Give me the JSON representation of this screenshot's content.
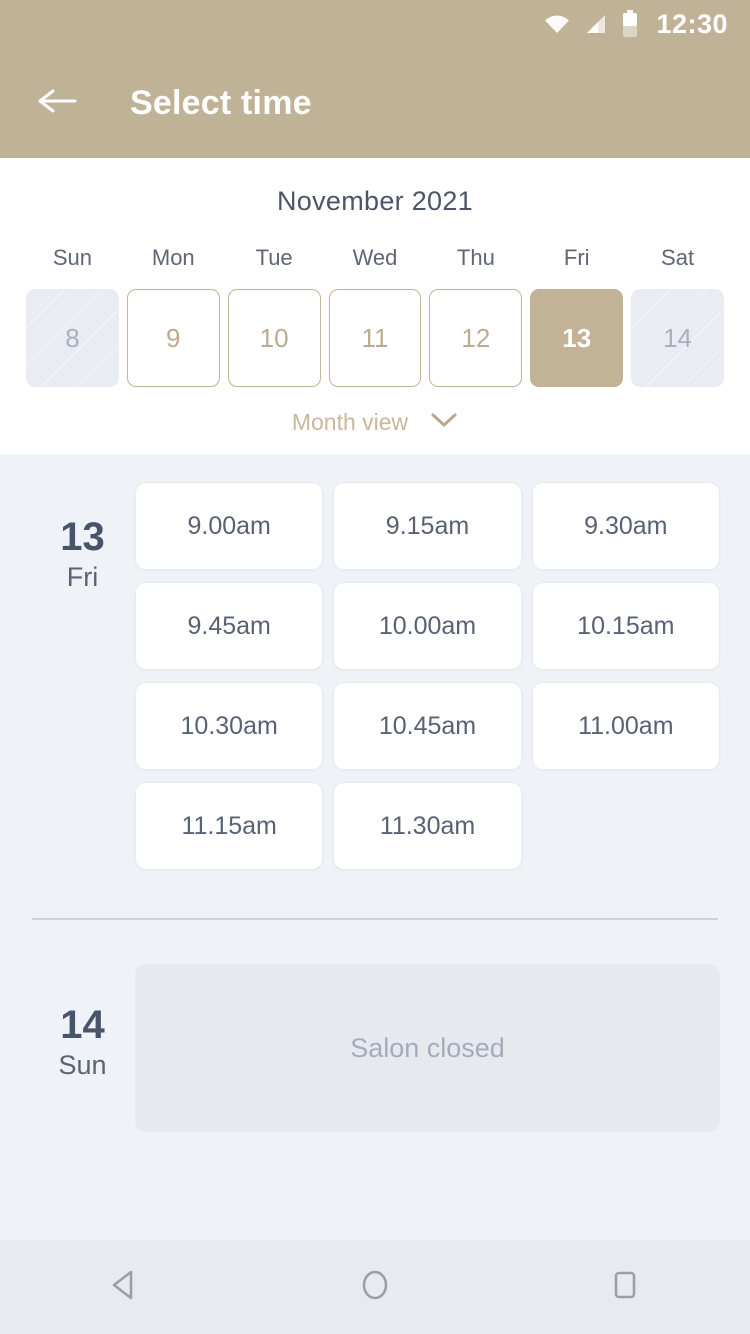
{
  "status_bar": {
    "time": "12:30",
    "icons": [
      "wifi-icon",
      "signal-icon",
      "battery-icon"
    ]
  },
  "app_bar": {
    "back_icon": "back-arrow-icon",
    "title": "Select time"
  },
  "calendar": {
    "month_title": "November 2021",
    "day_names": [
      "Sun",
      "Mon",
      "Tue",
      "Wed",
      "Thu",
      "Fri",
      "Sat"
    ],
    "dates": [
      {
        "number": "8",
        "state": "disabled"
      },
      {
        "number": "9",
        "state": "available"
      },
      {
        "number": "10",
        "state": "available"
      },
      {
        "number": "11",
        "state": "available"
      },
      {
        "number": "12",
        "state": "available"
      },
      {
        "number": "13",
        "state": "selected"
      },
      {
        "number": "14",
        "state": "disabled"
      }
    ],
    "view_toggle_label": "Month view",
    "view_toggle_icon": "chevron-down-icon"
  },
  "day_groups": [
    {
      "date_number": "13",
      "day_name": "Fri",
      "slots": [
        "9.00am",
        "9.15am",
        "9.30am",
        "9.45am",
        "10.00am",
        "10.15am",
        "10.30am",
        "10.45am",
        "11.00am",
        "11.15am",
        "11.30am"
      ]
    },
    {
      "date_number": "14",
      "day_name": "Sun",
      "closed_message": "Salon closed"
    }
  ],
  "nav_bar": {
    "back_icon": "nav-back-triangle-icon",
    "home_icon": "nav-home-circle-icon",
    "recents_icon": "nav-recents-square-icon"
  },
  "colors": {
    "accent_tan": "#c0b296",
    "body_bg": "#eff2f7",
    "text_slate": "#4d5568",
    "disabled_bg": "#e9edf3",
    "nav_bg": "#e7eaee"
  }
}
